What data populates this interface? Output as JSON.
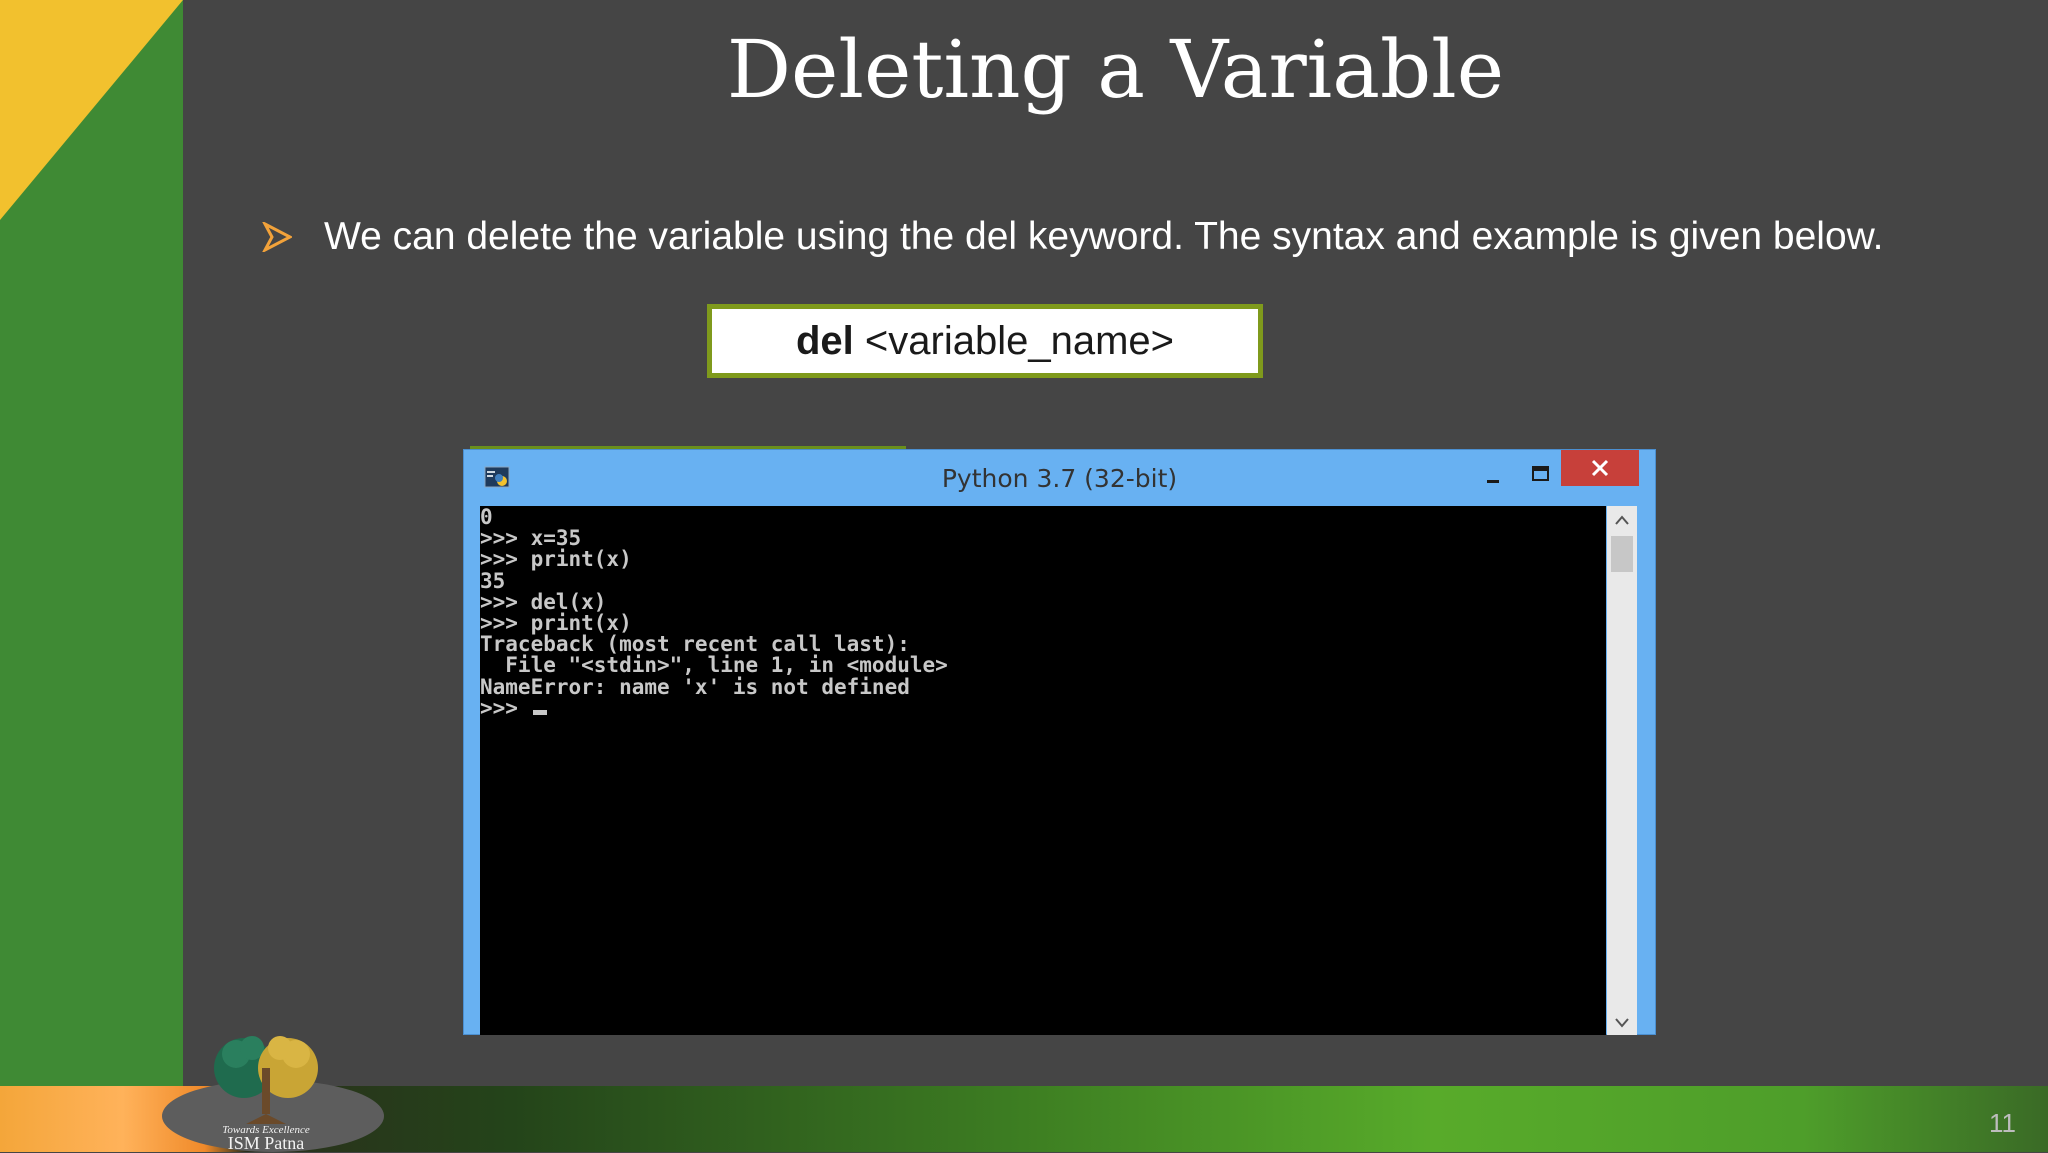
{
  "slide": {
    "title": "Deleting a Variable",
    "bullet_text": "We can delete the variable using the del keyword. The syntax  and example is given below.",
    "syntax_keyword": "del",
    "syntax_rest": " <variable_name>",
    "page_number": "11"
  },
  "logo": {
    "tagline": "Towards Excellence",
    "name": "ISM Patna"
  },
  "window": {
    "title": "Python 3.7 (32-bit)",
    "console_lines": [
      "0",
      ">>> x=35",
      ">>> print(x)",
      "35",
      ">>> del(x)",
      ">>> print(x)",
      "Traceback (most recent call last):",
      "  File \"<stdin>\", line 1, in <module>",
      "NameError: name 'x' is not defined",
      ">>> "
    ]
  },
  "colors": {
    "background": "#454545",
    "left_band": "#3f8a34",
    "corner_yellow": "#f2c12e",
    "titlebar": "#68b1f2",
    "close_button": "#c7403a",
    "syntax_border": "#7f9a1c",
    "bullet_arrow": "#f2a23a"
  },
  "icons": {
    "bullet": "arrow-bullet-icon",
    "app": "python-icon",
    "minimize": "minimize-icon",
    "maximize": "maximize-icon",
    "close": "close-icon"
  }
}
